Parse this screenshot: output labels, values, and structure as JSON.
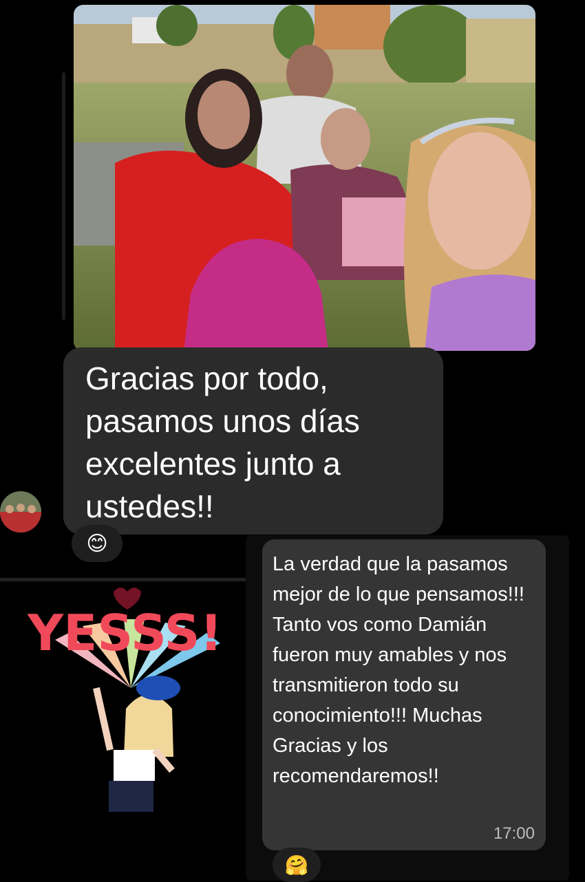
{
  "messages": {
    "received_text": "Gracias por todo, pasamos unos días excelentes junto a ustedes!!",
    "sent_text": "La verdad que la pasamos mejor de lo que pensamos!!! Tanto vos como Damián fueron muy amables y nos transmitieron todo su conocimiento!!! Muchas Gracias y los recomendaremos!!",
    "sent_time": "17:00"
  },
  "reactions": {
    "received": "😊",
    "sent": "🤗"
  },
  "icons": {
    "reaction_smile": "smiling-face-icon",
    "reaction_hug": "hugging-face-icon"
  },
  "sticker": {
    "text": "YESSS!"
  },
  "colors": {
    "received_bubble": "#2b2b2b",
    "sent_bubble": "#353535",
    "background": "#000000"
  }
}
